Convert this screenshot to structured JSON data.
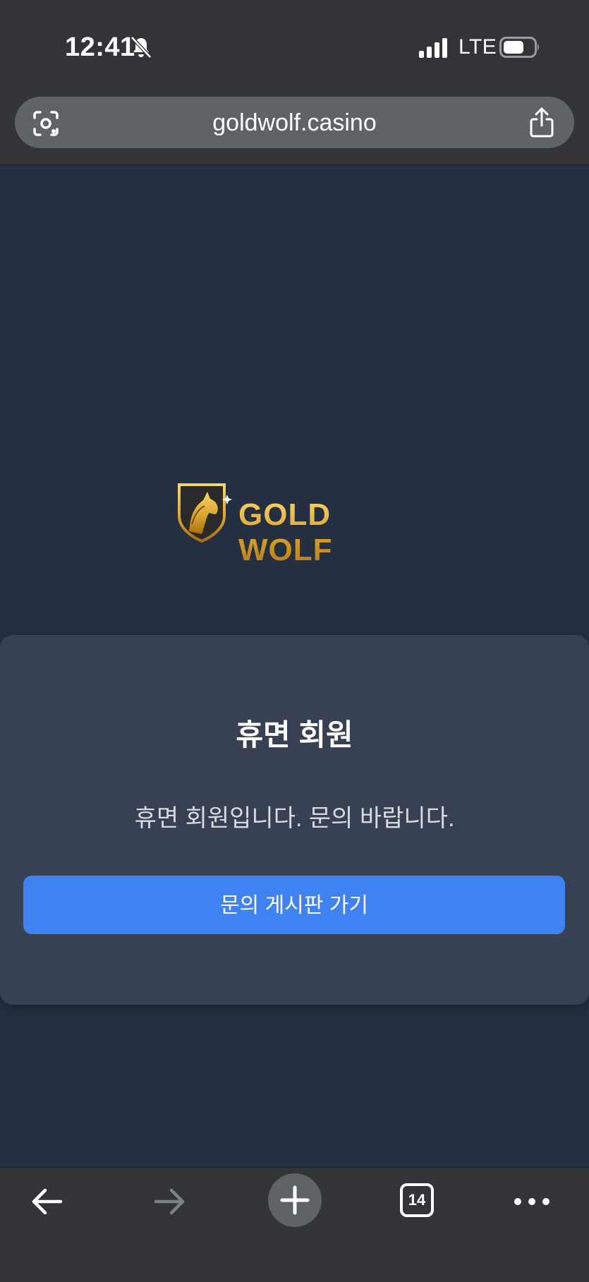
{
  "status_bar": {
    "time": "12:41",
    "network": "LTE",
    "icons": [
      "bell-slash-icon",
      "signal-icon",
      "battery-icon"
    ]
  },
  "browser": {
    "url": "goldwolf.casino",
    "icons": [
      "lens-icon",
      "share-icon"
    ]
  },
  "brand": {
    "logo_text": "GOLD WOLF",
    "gold_color": "#e3b13e"
  },
  "dialog": {
    "title": "휴면 회원",
    "message": "휴면 회원입니다. 문의 바랍니다.",
    "button_label": "문의 게시판 가기",
    "button_color": "#3f83f2"
  },
  "toolbar": {
    "tab_count": "14",
    "icons": [
      "back-arrow-icon",
      "forward-arrow-icon",
      "plus-icon",
      "tabs-icon",
      "more-icon"
    ]
  },
  "colors": {
    "page_background": "#252f42",
    "card_background": "#374153",
    "chrome_background": "#323438"
  }
}
